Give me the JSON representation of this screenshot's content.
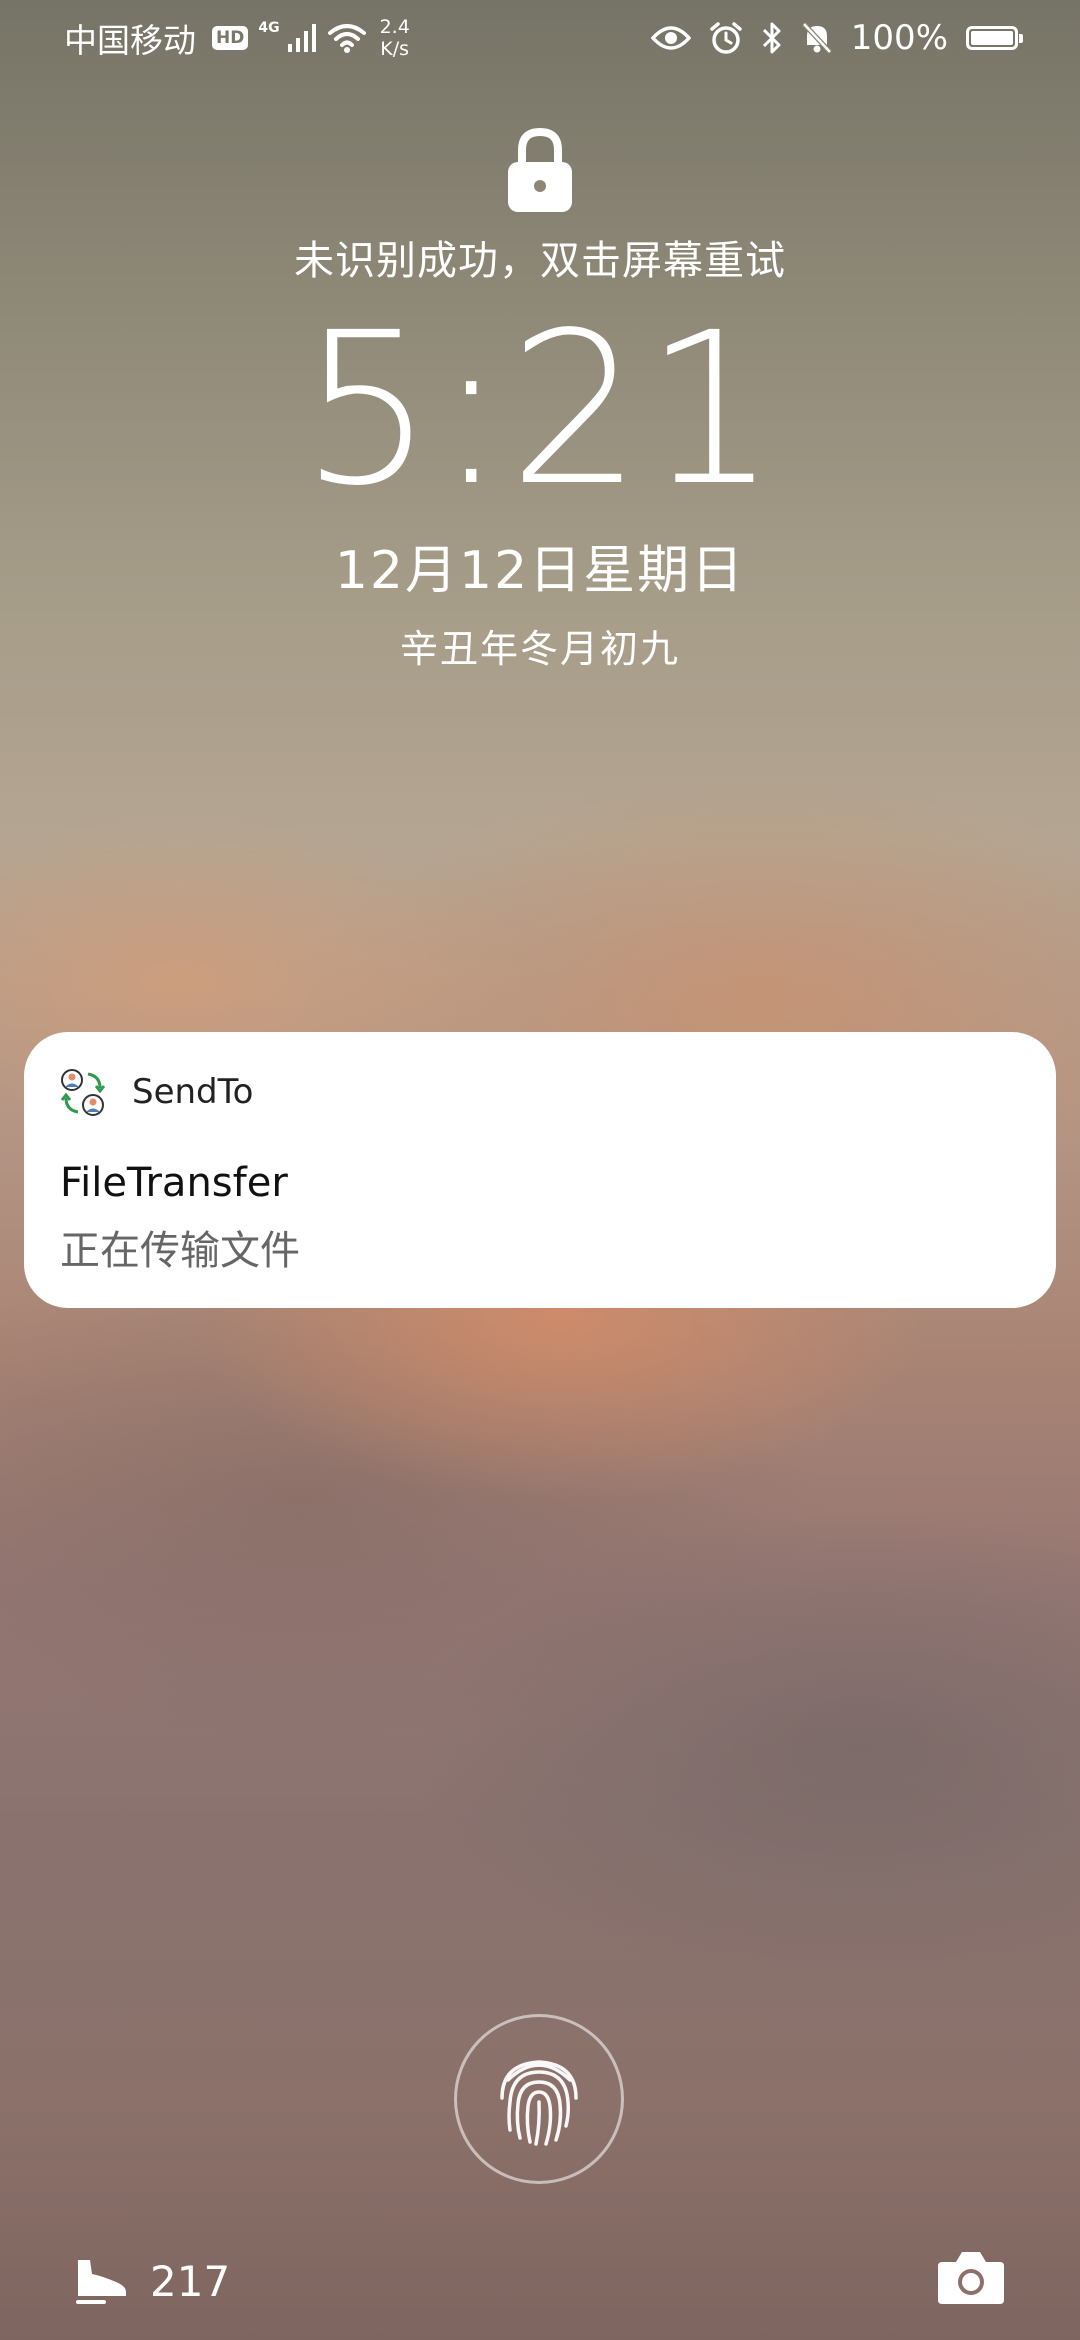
{
  "status_bar": {
    "carrier": "中国移动",
    "hd_badge": "HD",
    "network_type": "4G",
    "net_speed_value": "2.4",
    "net_speed_unit": "K/s",
    "battery_level": 1.0,
    "battery_percent": "100%",
    "icons": [
      "signal-icon",
      "wifi-icon",
      "eye-icon",
      "alarm-icon",
      "bluetooth-icon",
      "mute-icon",
      "battery-icon"
    ]
  },
  "lock_screen": {
    "lock_icon": "lock-icon",
    "unlock_hint": "未识别成功，双击屏幕重试",
    "time": "5:21",
    "date": "12月12日星期日",
    "lunar_date": "辛丑年冬月初九"
  },
  "notification": {
    "app_icon": "sendto-app-icon",
    "app_name": "SendTo",
    "title": "FileTransfer",
    "body": "正在传输文件"
  },
  "bottom": {
    "fingerprint_icon": "fingerprint-icon",
    "steps_icon": "shoe-icon",
    "steps_count": "217",
    "camera_icon": "camera-icon"
  },
  "colors": {
    "card_background": "#ffffff",
    "text_primary": "#111111",
    "text_secondary": "#666666"
  }
}
